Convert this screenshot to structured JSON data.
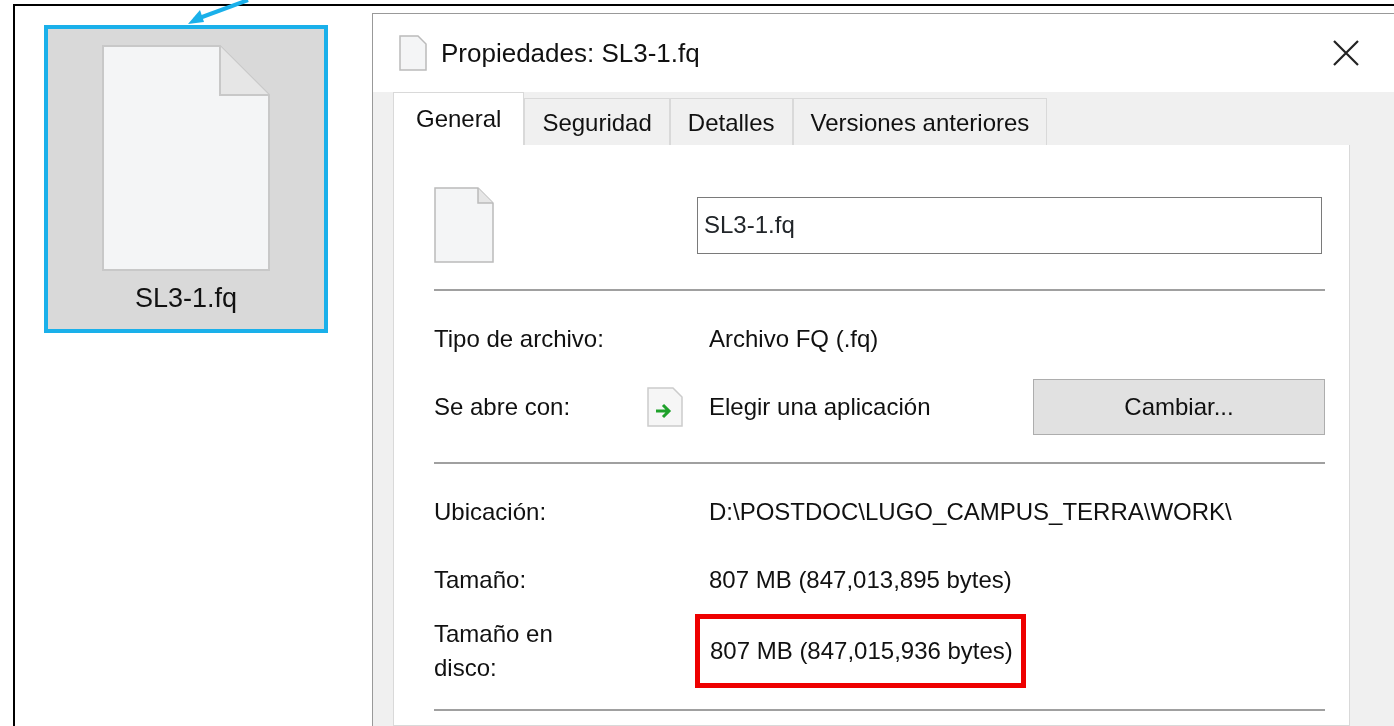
{
  "desktop_item": {
    "name": "SL3-1.fq",
    "selected": true
  },
  "dialog": {
    "title": "Propiedades: SL3-1.fq",
    "tabs": [
      {
        "label": "General",
        "selected": true
      },
      {
        "label": "Seguridad",
        "selected": false
      },
      {
        "label": "Detalles",
        "selected": false
      },
      {
        "label": "Versiones anteriores",
        "selected": false
      }
    ],
    "file_name": "SL3-1.fq",
    "sections": [
      [
        {
          "kind": "text",
          "label": "Tipo de archivo:",
          "value": "Archivo FQ (.fq)",
          "highlighted": false
        },
        {
          "kind": "opener",
          "label": "Se abre con:",
          "value": "Elegir una aplicación",
          "button": "Cambiar..."
        }
      ],
      [
        {
          "kind": "text",
          "label": "Ubicación:",
          "value": "D:\\POSTDOC\\LUGO_CAMPUS_TERRA\\WORK\\",
          "highlighted": false
        },
        {
          "kind": "text",
          "label": "Tamaño:",
          "value": "807 MB (847,013,895 bytes)",
          "highlighted": false
        },
        {
          "kind": "text",
          "label": "Tamaño en\ndisco:",
          "value": "807 MB (847,015,936 bytes)",
          "highlighted": true
        }
      ]
    ]
  }
}
